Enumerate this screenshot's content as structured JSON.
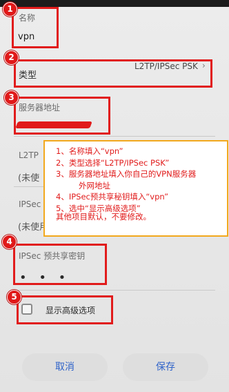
{
  "form": {
    "name_label": "名称",
    "name_value": "vpn",
    "type_label": "类型",
    "type_value": "L2TP/IPSec PSK",
    "server_label": "服务器地址",
    "l2tp_label": "L2TP",
    "l2tp_value": "(未使",
    "ipsec_label": "IPSec",
    "ipsec_value": "(未使用",
    "psk_label": "IPSec 预共享密钥",
    "psk_value": "• • •",
    "advanced_label": "显示高级选项"
  },
  "buttons": {
    "cancel": "取消",
    "save": "保存"
  },
  "badges": [
    "1",
    "2",
    "3",
    "4",
    "5"
  ],
  "note": {
    "lines": [
      "1、名称填入“vpn”",
      "2、类型选择“L2TP/IPSec PSK”",
      "3、服务器地址填入你自己的VPN服务器",
      "外网地址",
      "4、IPSec预共享秘钥填入“vpn”",
      "5、选中“显示高级选项”",
      "其他项目默认，不要修改。"
    ]
  },
  "colors": {
    "annotation_red": "#e11b1b",
    "note_border": "#f2a81d",
    "button_text": "#2f63c9"
  },
  "icons": {
    "type_dropdown": "chevron-right-icon",
    "advanced_checkbox": "checkbox-icon"
  }
}
